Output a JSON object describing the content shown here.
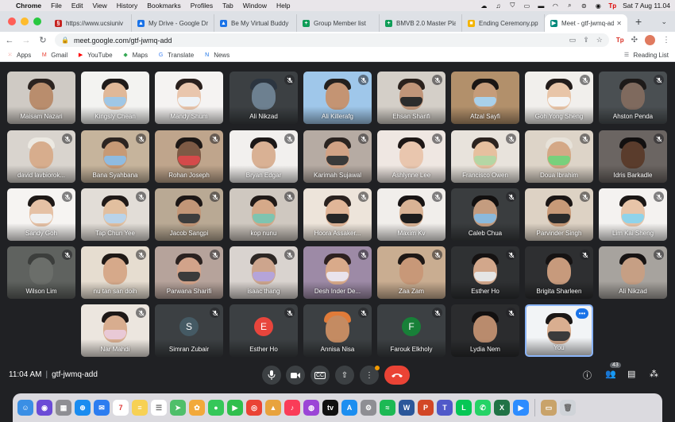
{
  "menubar": {
    "app": "Chrome",
    "items": [
      "File",
      "Edit",
      "View",
      "History",
      "Bookmarks",
      "Profiles",
      "Tab",
      "Window",
      "Help"
    ],
    "clock": "Sat 7 Aug  11.04",
    "tp_label": "Tp"
  },
  "tabs": [
    {
      "title": "https://www.ucsiuniv",
      "color": "#c5221f",
      "glyph": "§"
    },
    {
      "title": "My Drive - Google Dri",
      "color": "#1a73e8",
      "glyph": "▲"
    },
    {
      "title": "Be My Virtual Buddy",
      "color": "#1a73e8",
      "glyph": "▲"
    },
    {
      "title": "Group Member list",
      "color": "#0f9d58",
      "glyph": "+"
    },
    {
      "title": "BMVB 2.0 Master Pla",
      "color": "#0f9d58",
      "glyph": "+"
    },
    {
      "title": "Ending Ceremony.pptx",
      "color": "#f4b400",
      "glyph": "■"
    },
    {
      "title": "Meet - gtf-jwmq-add",
      "color": "#00897b",
      "glyph": "▶",
      "active": true
    }
  ],
  "address": {
    "url": "meet.google.com/gtf-jwmq-add"
  },
  "bookmarks": [
    {
      "label": "Apps",
      "color": "#ea4335",
      "glyph": "⁙"
    },
    {
      "label": "Gmail",
      "color": "#ea4335",
      "glyph": "M"
    },
    {
      "label": "YouTube",
      "color": "#ff0000",
      "glyph": "▶"
    },
    {
      "label": "Maps",
      "color": "#34a853",
      "glyph": "◆"
    },
    {
      "label": "Translate",
      "color": "#4285f4",
      "glyph": "G"
    },
    {
      "label": "News",
      "color": "#1a73e8",
      "glyph": "N"
    }
  ],
  "reading_list": "Reading List",
  "participants": [
    {
      "name": "Maisam Nazari",
      "bg": "#cfcac4",
      "skin": "#b98d6d",
      "hair": "#2b2320",
      "mask": "",
      "muted": false
    },
    {
      "name": "Kingsly Chean",
      "bg": "#f3f3f1",
      "skin": "#e0b898",
      "hair": "#1f1b1a",
      "mask": "#9fc7e6",
      "muted": false
    },
    {
      "name": "Mandy Shum",
      "bg": "#f5f3f2",
      "skin": "#e9c6ad",
      "hair": "#2a201d",
      "mask": "#eef2f6",
      "muted": false
    },
    {
      "name": "Ali Nikzad",
      "bg": "#3c4043",
      "skin": "#6d8090",
      "hair": "#2c3540",
      "mask": "",
      "muted": true
    },
    {
      "name": "Ali Killerafg",
      "bg": "#9fc7ea",
      "skin": "#c49473",
      "hair": "#23201e",
      "mask": "",
      "muted": true
    },
    {
      "name": "Ehsan Sharifi",
      "bg": "#d4cfc8",
      "skin": "#c09579",
      "hair": "#2a211d",
      "mask": "#2c2c2c",
      "muted": true
    },
    {
      "name": "Afzal Sayfi",
      "bg": "#b2906b",
      "skin": "#c59c7a",
      "hair": "#1a1614",
      "mask": "#a9d0ea",
      "muted": false
    },
    {
      "name": "Goh Yong Sheng",
      "bg": "#f1efec",
      "skin": "#e8c5a8",
      "hair": "#221c1a",
      "mask": "#f4f4f4",
      "muted": true
    },
    {
      "name": "Ahston Penda",
      "bg": "#4a4f52",
      "skin": "#7f6a5e",
      "hair": "#1d1a19",
      "mask": "",
      "muted": true
    },
    {
      "name": "david lavbiorok...",
      "bg": "#d9d4ce",
      "skin": "#d7ad8d",
      "hair": "#ece9e2",
      "mask": "",
      "muted": true
    },
    {
      "name": "Bana Syahbana",
      "bg": "#c6b49c",
      "skin": "#c79a76",
      "hair": "#2d2521",
      "mask": "#8fbbe0",
      "muted": true
    },
    {
      "name": "Rohan Joseph",
      "bg": "#bfa58c",
      "skin": "#7d5a45",
      "hair": "#1d1816",
      "mask": "#d44a4a",
      "muted": true
    },
    {
      "name": "Bryan Edgar",
      "bg": "#f2f0ee",
      "skin": "#d9b194",
      "hair": "#1c1818",
      "mask": "",
      "muted": true
    },
    {
      "name": "Karimah Sujawal",
      "bg": "#b6aba3",
      "skin": "#d1a285",
      "hair": "#2a2320",
      "mask": "#3a3a3a",
      "muted": true
    },
    {
      "name": "Ashlynne Lee",
      "bg": "#efe7e2",
      "skin": "#e9c6ae",
      "hair": "#1d1716",
      "mask": "",
      "muted": true
    },
    {
      "name": "Francisco Owen",
      "bg": "#e8e3dc",
      "skin": "#e6c09f",
      "hair": "#2b231f",
      "mask": "#b4d6a4",
      "muted": true
    },
    {
      "name": "Doua Ibrahim",
      "bg": "#ddd4c8",
      "skin": "#d4a886",
      "hair": "#e7e2d9",
      "mask": "#78d07c",
      "muted": true
    },
    {
      "name": "Idris Barkadle",
      "bg": "#6b6562",
      "skin": "#5a3c2c",
      "hair": "#121010",
      "mask": "",
      "muted": true
    },
    {
      "name": "Sandy Goh",
      "bg": "#f6f4f2",
      "skin": "#e5c1a5",
      "hair": "#1e1917",
      "mask": "#f0f0f0",
      "muted": true
    },
    {
      "name": "Tap Chun Yee",
      "bg": "#e2ddd7",
      "skin": "#e2bf9f",
      "hair": "#201a18",
      "mask": "#b9d3ea",
      "muted": true
    },
    {
      "name": "Jacob Sangpi",
      "bg": "#b9a994",
      "skin": "#c29677",
      "hair": "#1c1716",
      "mask": "#3d3d3d",
      "muted": true
    },
    {
      "name": "kop nunu",
      "bg": "#cfc8c0",
      "skin": "#d5a989",
      "hair": "#201a18",
      "mask": "#7fc4b0",
      "muted": true
    },
    {
      "name": "Hoora Assaker...",
      "bg": "#ede4da",
      "skin": "#e1b698",
      "hair": "#2a211e",
      "mask": "#262626",
      "muted": true
    },
    {
      "name": "Maxim Kv",
      "bg": "#f1eeeb",
      "skin": "#d9b395",
      "hair": "#181414",
      "mask": "#1d1d1d",
      "muted": true
    },
    {
      "name": "Caleb Chua",
      "bg": "#3a3d3f",
      "skin": "#c49c7f",
      "hair": "#121010",
      "mask": "#8bb9dc",
      "muted": true
    },
    {
      "name": "Parvinder Singh",
      "bg": "#ddd2c4",
      "skin": "#c89a78",
      "hair": "#1b1615",
      "mask": "#2a2a2a",
      "muted": true
    },
    {
      "name": "Lim Kai Sheng",
      "bg": "#f4f2f0",
      "skin": "#e7c4a8",
      "hair": "#1b1716",
      "mask": "#8fd3ea",
      "muted": true
    },
    {
      "name": "Wilson Lim",
      "bg": "#5f625f",
      "skin": "#6b6e6a",
      "hair": "#3c3e3c",
      "mask": "",
      "muted": true
    },
    {
      "name": "nu tan san doih",
      "bg": "#e6ddd0",
      "skin": "#d6a98a",
      "hair": "#1f1916",
      "mask": "",
      "muted": true
    },
    {
      "name": "Parwana Sharifi",
      "bg": "#b6a39b",
      "skin": "#d2a38a",
      "hair": "#2b2220",
      "mask": "#3b3b3b",
      "muted": true
    },
    {
      "name": "isaac thang",
      "bg": "#d9d3cf",
      "skin": "#cda58d",
      "hair": "#2d2724",
      "mask": "#b5a4d9",
      "muted": true
    },
    {
      "name": "Desh Inder De...",
      "bg": "#9d8aa6",
      "skin": "#d9aa8a",
      "hair": "#2d2120",
      "mask": "#e9e3ec",
      "muted": true
    },
    {
      "name": "Zaa Zam",
      "bg": "#c9ad91",
      "skin": "#c89878",
      "hair": "#1e1816",
      "mask": "",
      "muted": true
    },
    {
      "name": "Esther Ho",
      "bg": "#2f3133",
      "skin": "#d2a78b",
      "hair": "#151212",
      "mask": "#e5e5e5",
      "muted": true
    },
    {
      "name": "Brigita Sharleen",
      "bg": "#2e2f31",
      "skin": "#c79a7c",
      "hair": "#161313",
      "mask": "",
      "muted": true
    },
    {
      "name": "Ali Nikzad",
      "bg": "#a7a39e",
      "skin": "#c69f84",
      "hair": "#171414",
      "mask": "",
      "muted": true
    },
    {
      "name": "Nar Mahdi",
      "bg": "#ece6df",
      "skin": "#d8ad8f",
      "hair": "#1d1817",
      "mask": "#e9c9d6",
      "muted": true
    },
    {
      "name": "Simran Zubair",
      "bg": "#3c4043",
      "initial": "S",
      "initial_bg": "#455a64",
      "muted": true
    },
    {
      "name": "Esther Ho",
      "bg": "#3c4043",
      "initial": "E",
      "initial_bg": "#e8453c",
      "muted": true
    },
    {
      "name": "Annisa Nisa",
      "bg": "#3c4043",
      "skin": "#c48b62",
      "hair": "#e07b39",
      "mask": "",
      "muted": true
    },
    {
      "name": "Farouk Elkholy",
      "bg": "#3c4043",
      "initial": "F",
      "initial_bg": "#188038",
      "muted": true
    },
    {
      "name": "Lydia Nem",
      "bg": "#2b2c2e",
      "skin": "#b98b6d",
      "hair": "#121010",
      "mask": "",
      "muted": true
    },
    {
      "name": "You",
      "bg": "#f2f4f6",
      "skin": "#d9ae90",
      "hair": "#1b1716",
      "mask": "#3b3b3b",
      "muted": false,
      "self": true
    }
  ],
  "meeting": {
    "time": "11:04 AM",
    "code": "gtf-jwmq-add",
    "participant_count": "43"
  },
  "dock": [
    {
      "name": "finder",
      "color": "#3a8fe5",
      "glyph": "☺"
    },
    {
      "name": "siri",
      "color": "#6b4bd6",
      "glyph": "◉"
    },
    {
      "name": "launchpad",
      "color": "#8e8e93",
      "glyph": "▦"
    },
    {
      "name": "safari",
      "color": "#1a8cf0",
      "glyph": "⊕"
    },
    {
      "name": "mail",
      "color": "#2c7df0",
      "glyph": "✉"
    },
    {
      "name": "calendar",
      "color": "#ffffff",
      "glyph": "7",
      "text": "#d33"
    },
    {
      "name": "notes",
      "color": "#f7d154",
      "glyph": "≡"
    },
    {
      "name": "reminders",
      "color": "#ffffff",
      "glyph": "☰",
      "text": "#777"
    },
    {
      "name": "maps",
      "color": "#4fbf6a",
      "glyph": "➤"
    },
    {
      "name": "photos",
      "color": "#f2a93b",
      "glyph": "✿"
    },
    {
      "name": "messages",
      "color": "#35c759",
      "glyph": "●"
    },
    {
      "name": "facetime",
      "color": "#2fbf4d",
      "glyph": "▶"
    },
    {
      "name": "chrome",
      "color": "#ea4335",
      "glyph": "◎"
    },
    {
      "name": "keynote",
      "color": "#e8a33d",
      "glyph": "▲"
    },
    {
      "name": "music",
      "color": "#fa3c58",
      "glyph": "♪"
    },
    {
      "name": "podcasts",
      "color": "#9b45d6",
      "glyph": "◍"
    },
    {
      "name": "tv",
      "color": "#111111",
      "glyph": "tv"
    },
    {
      "name": "app-store",
      "color": "#1c8ef0",
      "glyph": "A"
    },
    {
      "name": "settings",
      "color": "#8e8e93",
      "glyph": "⚙"
    },
    {
      "name": "spotify",
      "color": "#1db954",
      "glyph": "≈"
    },
    {
      "name": "word",
      "color": "#2b579a",
      "glyph": "W"
    },
    {
      "name": "powerpoint",
      "color": "#d24726",
      "glyph": "P"
    },
    {
      "name": "teams",
      "color": "#5059c9",
      "glyph": "T"
    },
    {
      "name": "line",
      "color": "#06c755",
      "glyph": "L"
    },
    {
      "name": "whatsapp",
      "color": "#25d366",
      "glyph": "✆"
    },
    {
      "name": "excel",
      "color": "#217346",
      "glyph": "X"
    },
    {
      "name": "zoom",
      "color": "#2d8cff",
      "glyph": "▶"
    },
    {
      "name": "archive",
      "color": "#c9a36a",
      "glyph": "▭"
    },
    {
      "name": "trash",
      "color": "#cfd3d8",
      "glyph": "🗑",
      "text": "#666"
    }
  ]
}
